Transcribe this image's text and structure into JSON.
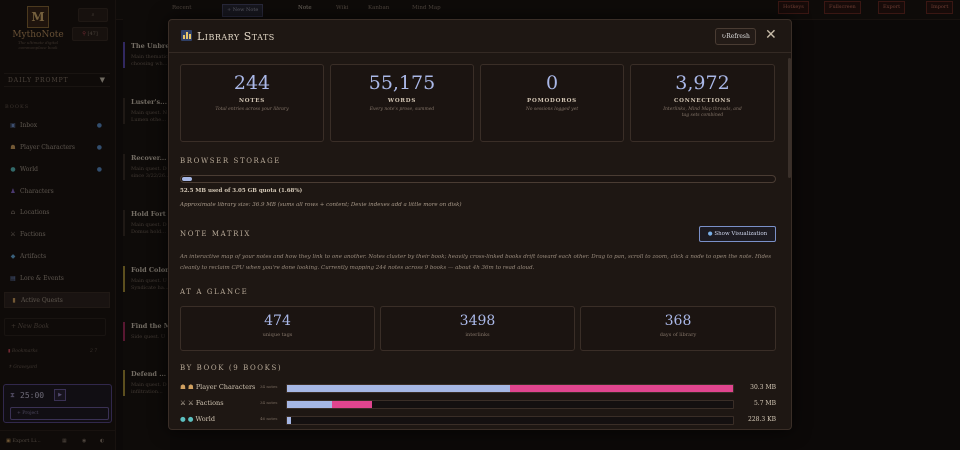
{
  "app": {
    "brand": "MythoNote",
    "tagline_line1": "The ultimate digital",
    "tagline_line2": "commonplace book",
    "pin_count": "[47]"
  },
  "sidebar": {
    "daily_prompt": "DAILY PROMPT",
    "books_title": "BOOKS",
    "books": [
      {
        "label": "Inbox",
        "icon": "inbox-icon"
      },
      {
        "label": "Player Characters",
        "icon": "characters-icon"
      },
      {
        "label": "World",
        "icon": "globe-icon"
      },
      {
        "label": "Characters",
        "icon": "person-icon"
      },
      {
        "label": "Locations",
        "icon": "map-icon"
      },
      {
        "label": "Factions",
        "icon": "swords-icon"
      },
      {
        "label": "Artifacts",
        "icon": "gem-icon"
      },
      {
        "label": "Lore & Events",
        "icon": "book-icon"
      },
      {
        "label": "Active Quests",
        "icon": "quest-icon"
      }
    ],
    "new_book": "+ New Book",
    "bookmarks": "Bookmarks",
    "bookmarks_count": "2 7",
    "graveyard": "Graveyard",
    "timer": "25:00",
    "project_placeholder": "+ Project",
    "footer": "Export Li..."
  },
  "topbar": {
    "recent": "Recent",
    "new_note": "+ New Note",
    "tabs": [
      "Note",
      "Wiki",
      "Kanban",
      "Mind Map"
    ],
    "right_buttons": [
      "Hotkeys",
      "Fullscreen",
      "Export",
      "Import"
    ]
  },
  "notes": [
    {
      "title": "The Unbrea...",
      "body1": "Main thematic",
      "body2": "choosing wh..."
    },
    {
      "title": "Luster's...",
      "body1": "Main quest. N",
      "body2": "Lumen othe..."
    },
    {
      "title": "Recover...",
      "body1": "Main quest. D",
      "body2": "since 3/22/26..."
    },
    {
      "title": "Hold Fort R...",
      "body1": "Main quest. D",
      "body2": "Domus hold..."
    },
    {
      "title": "Fold Colon...",
      "body1": "Main quest. U",
      "body2": "Syndicate ha..."
    },
    {
      "title": "Find the Ma...",
      "body1": "Side quest. U",
      "body2": ""
    },
    {
      "title": "Defend ...",
      "body1": "Main quest. D",
      "body2": "infiltration..."
    }
  ],
  "modal": {
    "title": "Library Stats",
    "refresh": "Refresh",
    "stats": [
      {
        "value": "244",
        "label": "NOTES",
        "sub": "Total entries across your library"
      },
      {
        "value": "55,175",
        "label": "WORDS",
        "sub": "Every note's prose, summed"
      },
      {
        "value": "0",
        "label": "POMODOROS",
        "sub": "No sessions logged yet"
      },
      {
        "value": "3,972",
        "label": "CONNECTIONS",
        "sub": "Interlinks, Mind Map threads, and tag sets combined"
      }
    ],
    "storage_title": "BROWSER STORAGE",
    "storage_used_fraction": 0.0168,
    "storage_line": "52.5 MB used of 3.05 GB quota (1.68%)",
    "storage_note": "Approximate library size: 36.9 MB (sums all rows + content; Dexie indexes add a little more on disk)",
    "matrix_title": "NOTE MATRIX",
    "viz_button": "Show Visualization",
    "matrix_text": "An interactive map of your notes and how they link to one another. Notes cluster by their book; heavily cross-linked books drift toward each other. Drag to pan, scroll to zoom, click a node to open the note. Hides cleanly to reclaim CPU when you're done looking. Currently mapping 244 notes across 9 books — about 4h 36m to read aloud.",
    "glance_title": "AT A GLANCE",
    "glance": [
      {
        "value": "474",
        "label": "unique tags"
      },
      {
        "value": "3498",
        "label": "interlinks"
      },
      {
        "value": "368",
        "label": "days of library"
      }
    ],
    "by_book_title": "BY BOOK (9 BOOKS)",
    "by_book": [
      {
        "name": "Player Characters",
        "count": "34 notes",
        "size": "30.3 MB",
        "share_a": 0.5,
        "share_b": 0.5
      },
      {
        "name": "Factions",
        "count": "34 notes",
        "size": "5.7 MB",
        "share_a": 0.1,
        "share_b": 0.09
      },
      {
        "name": "World",
        "count": "46 notes",
        "size": "228.3 KB",
        "share_a": 0.008,
        "share_b": 0
      }
    ]
  },
  "colors": {
    "accent": "#aab8e8",
    "pink": "#e0458e",
    "bar": "#a6b7e4"
  }
}
